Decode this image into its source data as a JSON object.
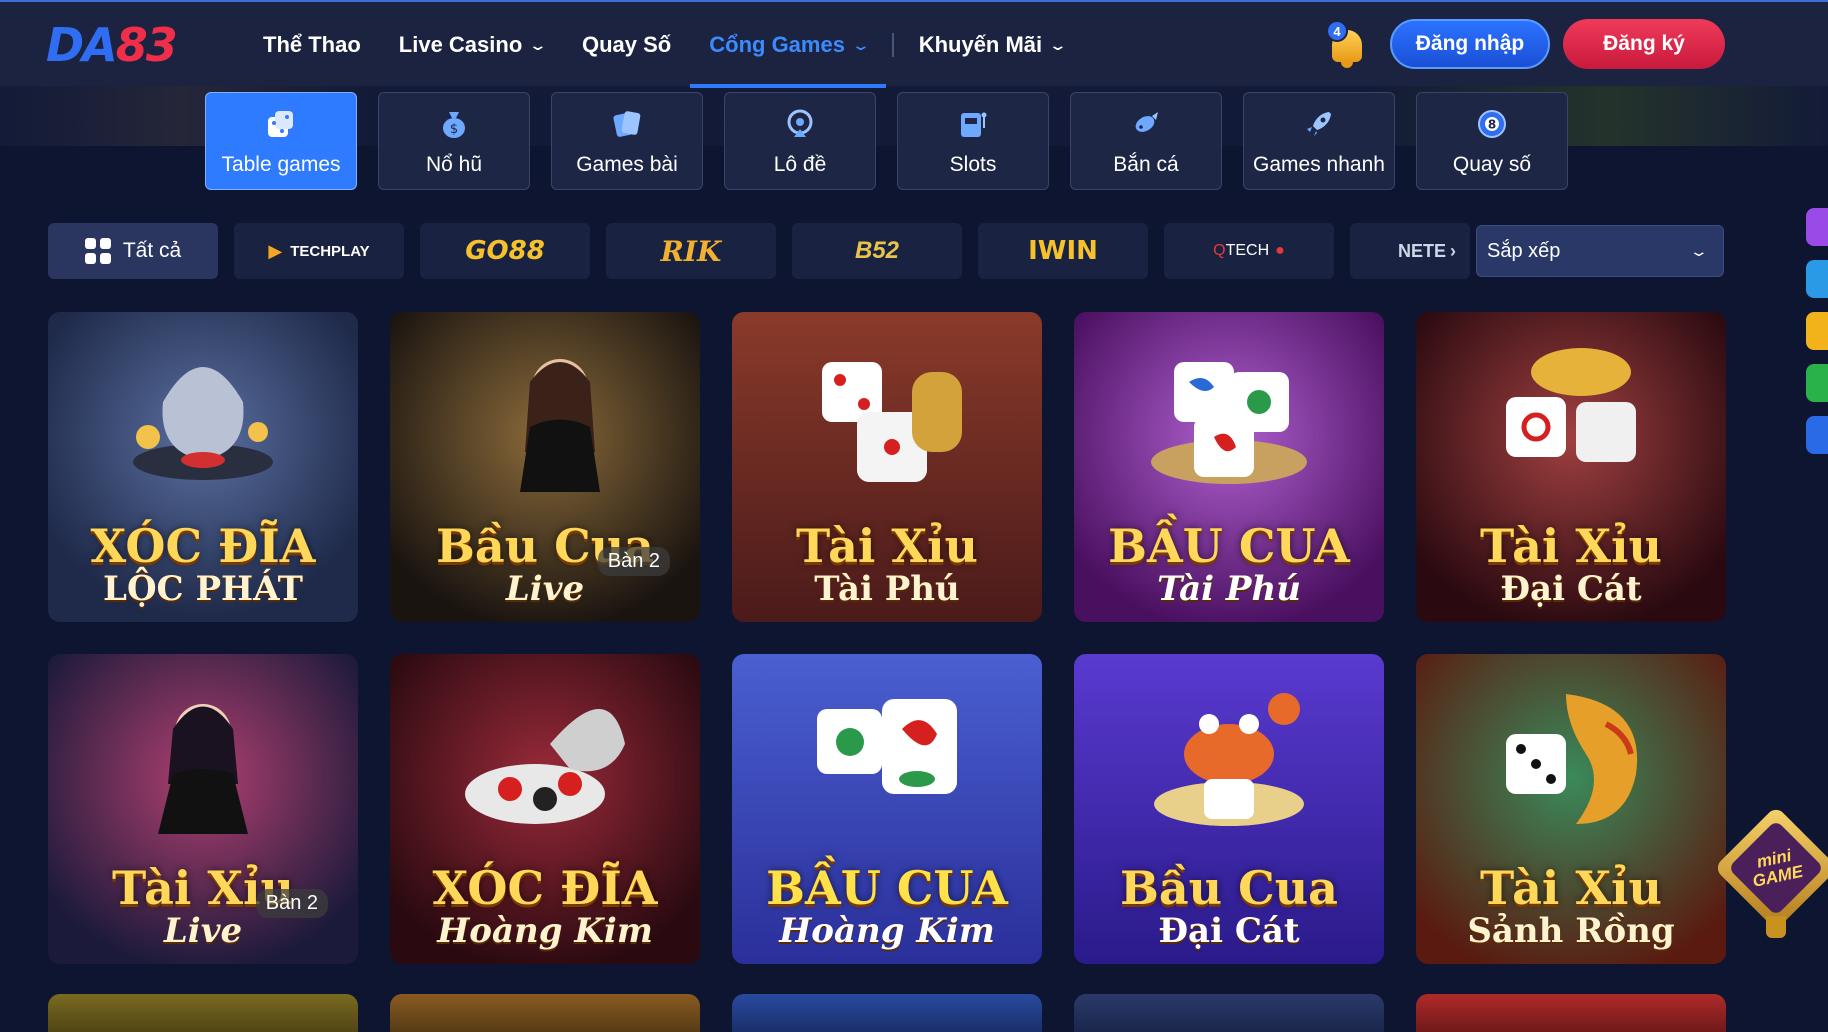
{
  "logo": {
    "da": "DA",
    "num": "83"
  },
  "nav": {
    "items": [
      {
        "label": "Thể Thao",
        "dropdown": false,
        "active": false
      },
      {
        "label": "Live Casino",
        "dropdown": true,
        "active": false
      },
      {
        "label": "Quay Số",
        "dropdown": false,
        "active": false
      },
      {
        "label": "Cổng Games",
        "dropdown": true,
        "active": true
      },
      {
        "label": "Khuyến Mãi",
        "dropdown": true,
        "active": false
      }
    ],
    "chevron": "⌄"
  },
  "notifications": {
    "count": "4",
    "icon": "bell-icon"
  },
  "auth": {
    "login": "Đăng nhập",
    "register": "Đăng ký"
  },
  "categories": [
    {
      "label": "Table games",
      "icon": "dice-icon",
      "active": true
    },
    {
      "label": "Nổ hũ",
      "icon": "money-bag-icon",
      "active": false
    },
    {
      "label": "Games bài",
      "icon": "cards-icon",
      "active": false
    },
    {
      "label": "Lô đề",
      "icon": "lottery-wheel-icon",
      "active": false
    },
    {
      "label": "Slots",
      "icon": "slot-machine-icon",
      "active": false
    },
    {
      "label": "Bắn cá",
      "icon": "fish-icon",
      "active": false
    },
    {
      "label": "Games nhanh",
      "icon": "rocket-icon",
      "active": false
    },
    {
      "label": "Quay số",
      "icon": "ball-8-icon",
      "active": false
    }
  ],
  "providers": {
    "all": "Tất cả",
    "techplay": "TECHPLAY",
    "go88": "GO88",
    "rik": "RIK",
    "b52": "B52",
    "iwin": "IWIN",
    "qtech_q": "Q",
    "qtech_rest": "TECH",
    "netent": "NETE"
  },
  "sort": {
    "label": "Sắp xếp",
    "chevron": "⌄"
  },
  "games": [
    {
      "line1": "XÓC ĐĨA",
      "line2": "LỘC PHÁT",
      "badge": ""
    },
    {
      "line1": "Bầu Cua",
      "line2": "Live",
      "badge": "Bàn 2"
    },
    {
      "line1": "Tài Xỉu",
      "line2": "Tài Phú",
      "badge": ""
    },
    {
      "line1": "BẦU CUA",
      "line2": "Tài Phú",
      "badge": ""
    },
    {
      "line1": "Tài Xỉu",
      "line2": "Đại Cát",
      "badge": ""
    },
    {
      "line1": "Tài Xỉu",
      "line2": "Live",
      "badge": "Bàn 2"
    },
    {
      "line1": "XÓC ĐĨA",
      "line2": "Hoàng Kim",
      "badge": ""
    },
    {
      "line1": "BẦU CUA",
      "line2": "Hoàng Kim",
      "badge": ""
    },
    {
      "line1": "Bầu Cua",
      "line2": "Đại Cát",
      "badge": ""
    },
    {
      "line1": "Tài Xỉu",
      "line2": "Sảnh Rồng",
      "badge": ""
    }
  ],
  "mini_game": {
    "line1": "mini",
    "line2": "GAME"
  },
  "colors": {
    "accent": "#2f7bff",
    "register": "#e8294a",
    "bg": "#0e1530"
  }
}
